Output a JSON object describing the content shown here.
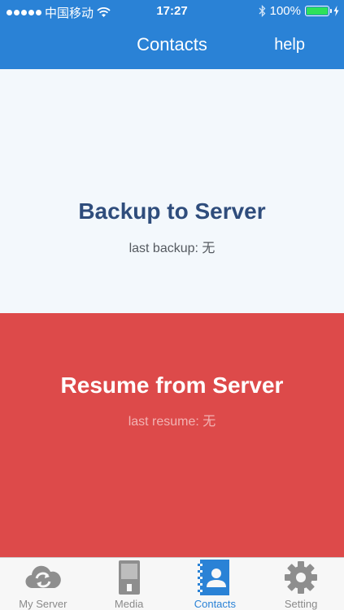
{
  "status_bar": {
    "carrier": "中国移动",
    "time": "17:27",
    "battery": "100%"
  },
  "nav": {
    "title": "Contacts",
    "help_label": "help"
  },
  "backup": {
    "title": "Backup to Server",
    "subtitle": "last backup: 无"
  },
  "resume": {
    "title": "Resume from Server",
    "subtitle": "last resume: 无"
  },
  "tabs": [
    {
      "label": "My Server",
      "icon": "cloud-sync-icon"
    },
    {
      "label": "Media",
      "icon": "media-player-icon"
    },
    {
      "label": "Contacts",
      "icon": "contacts-book-icon"
    },
    {
      "label": "Setting",
      "icon": "gear-icon"
    }
  ],
  "active_tab": "Contacts",
  "colors": {
    "header": "#2a82d6",
    "backup_bg": "#f3f8fc",
    "resume_bg": "#dd4a4a",
    "backup_title": "#2f4d7c",
    "active_tab": "#2a82d6"
  }
}
